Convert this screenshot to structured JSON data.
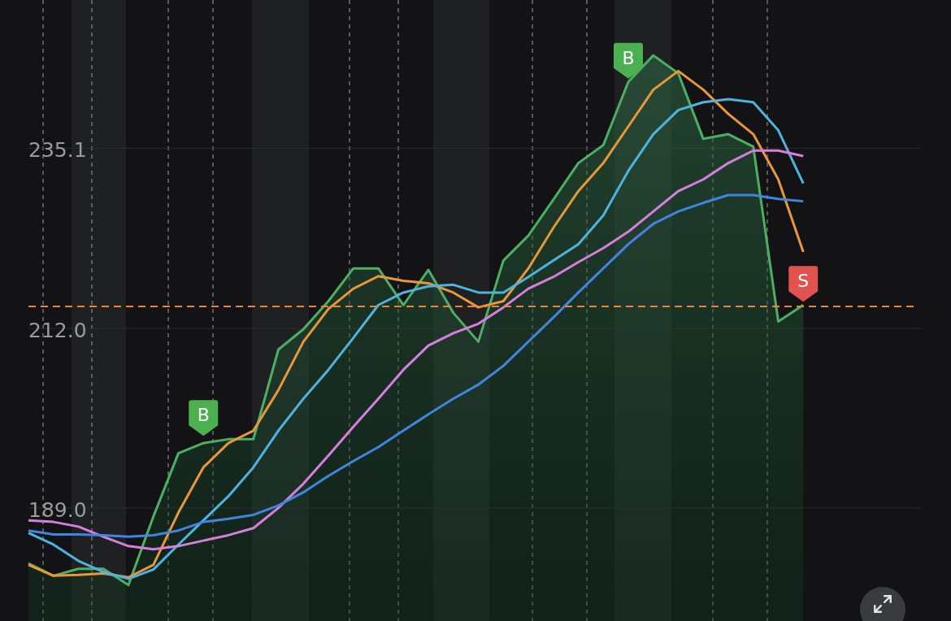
{
  "chart": {
    "chart_data": {
      "type": "line",
      "ylim": [
        174.5,
        254.1
      ],
      "grid": true,
      "yticks": [
        {
          "value": 189.0,
          "label": "189.0"
        },
        {
          "value": 212.0,
          "label": "212.0"
        },
        {
          "value": 235.1,
          "label": "235.1"
        }
      ],
      "series": [
        {
          "type": "area",
          "color": "#4caf64",
          "values": [
            181.9,
            180.3,
            181.2,
            181.2,
            179.1,
            187.9,
            196.0,
            197.3,
            197.8,
            197.8,
            209.3,
            211.9,
            215.5,
            219.7,
            219.7,
            215.0,
            219.5,
            214.0,
            210.3,
            220.7,
            223.9,
            228.5,
            233.2,
            235.5,
            243.6,
            247.0,
            244.7,
            236.3,
            236.9,
            235.3,
            212.9,
            215.0
          ]
        },
        {
          "type": "line",
          "color": "#e8973a",
          "values": [
            181.7,
            180.3,
            180.4,
            180.6,
            180.1,
            181.7,
            188.4,
            194.2,
            197.3,
            198.9,
            204.1,
            210.3,
            214.5,
            217.1,
            218.7,
            218.1,
            217.8,
            216.6,
            214.7,
            215.5,
            219.7,
            224.9,
            229.6,
            233.2,
            237.9,
            242.6,
            245.0,
            242.6,
            239.5,
            236.9,
            231.1,
            221.8
          ]
        },
        {
          "type": "line",
          "color": "#4fb3e0",
          "values": [
            185.8,
            184.3,
            182.2,
            180.8,
            179.9,
            181.1,
            184.3,
            187.4,
            190.5,
            194.2,
            198.9,
            203.0,
            206.7,
            210.8,
            215.0,
            216.6,
            217.4,
            217.6,
            216.6,
            216.6,
            218.6,
            220.7,
            222.8,
            226.5,
            232.2,
            236.9,
            240.0,
            241.0,
            241.4,
            241.0,
            237.4,
            230.6
          ]
        },
        {
          "type": "line",
          "color": "#d77fdc",
          "values": [
            187.4,
            187.2,
            186.6,
            185.3,
            184.1,
            183.7,
            184.1,
            184.8,
            185.5,
            186.4,
            189.0,
            192.1,
            195.7,
            199.4,
            203.0,
            206.7,
            209.8,
            211.4,
            212.6,
            214.7,
            217.1,
            218.6,
            220.5,
            222.3,
            224.4,
            227.0,
            229.6,
            231.1,
            233.2,
            234.8,
            234.8,
            234.1
          ]
        },
        {
          "type": "line",
          "color": "#3f86e0",
          "values": [
            186.1,
            185.6,
            185.6,
            185.5,
            185.3,
            185.5,
            186.1,
            187.2,
            187.6,
            188.1,
            189.3,
            191.0,
            193.1,
            195.0,
            196.8,
            198.9,
            201.0,
            203.0,
            204.8,
            207.2,
            210.3,
            213.4,
            216.6,
            219.7,
            222.8,
            225.4,
            227.0,
            228.1,
            229.1,
            229.1,
            228.6,
            228.3
          ]
        }
      ],
      "annotations": [
        {
          "y": 197.8,
          "text": "B"
        },
        {
          "y": 243.6,
          "text": "B"
        },
        {
          "y": 215.0,
          "text": "S"
        }
      ]
    },
    "signals": [
      {
        "kind": "buy"
      },
      {
        "kind": "buy"
      },
      {
        "kind": "sell"
      }
    ]
  }
}
